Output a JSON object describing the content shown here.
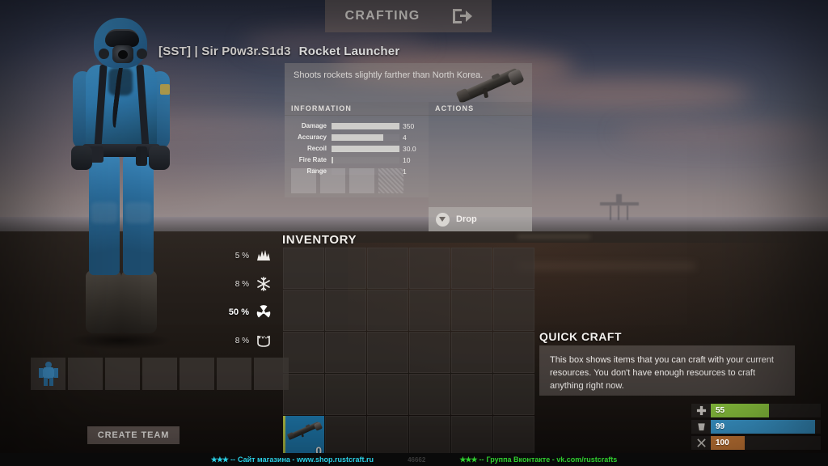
{
  "header": {
    "crafting_tab_label": "CRAFTING",
    "exit_icon": "exit-door-arrow-icon"
  },
  "item": {
    "owner_tag": "[SST] | Sir P0w3r.S1d3",
    "name": "Rocket Launcher",
    "description": "Shoots rockets slightly farther than North Korea.",
    "icon": "rocket-launcher-icon",
    "information_header": "INFORMATION",
    "actions_header": "ACTIONS",
    "stats": [
      {
        "label": "Damage",
        "value": "350",
        "fill_pct": 100
      },
      {
        "label": "Accuracy",
        "value": "4",
        "fill_pct": 76
      },
      {
        "label": "Recoil",
        "value": "30.0",
        "fill_pct": 100
      },
      {
        "label": "Fire Rate",
        "value": "10",
        "fill_pct": 2
      },
      {
        "label": "Range",
        "value": "1",
        "fill_pct": 0
      }
    ],
    "actions": {
      "drop_label": "Drop",
      "drop_icon": "chevron-down-circle-icon"
    }
  },
  "protection": [
    {
      "value": "5 %",
      "icon": "explosion-icon",
      "highlight": false
    },
    {
      "value": "8 %",
      "icon": "snowflake-icon",
      "highlight": false
    },
    {
      "value": "50 %",
      "icon": "radiation-icon",
      "highlight": true
    },
    {
      "value": "8 %",
      "icon": "bite-jaws-icon",
      "highlight": false
    }
  ],
  "inventory": {
    "title": "INVENTORY",
    "columns": 6,
    "rows": 5,
    "items": [
      {
        "slot": 24,
        "name": "Rocket Launcher",
        "icon": "rocket-launcher-icon",
        "count": "0",
        "condition_pct": 100
      }
    ]
  },
  "armor": {
    "slot_count": 7,
    "items": [
      {
        "slot": 0,
        "name": "Hazmat Suit",
        "icon": "hazmat-suit-icon"
      }
    ]
  },
  "create_team": {
    "label": "CREATE TEAM"
  },
  "quick_craft": {
    "title": "QUICK CRAFT",
    "body": "This box shows items that you can craft with your current resources. You don't have enough resources to craft anything right now."
  },
  "vitals": [
    {
      "name": "health",
      "icon": "cross-icon",
      "value": "55",
      "fill_pct": 55,
      "color": "#8cc63f"
    },
    {
      "name": "thirst",
      "icon": "droplet-icon",
      "value": "99",
      "fill_pct": 99,
      "color": "#3d9fd6"
    },
    {
      "name": "hunger",
      "icon": "bone-icon",
      "value": "100",
      "fill_pct": 32,
      "color": "#d4803a"
    }
  ],
  "banner": {
    "left_stars": "★★★",
    "left_dashes": "--",
    "left_text": "Сайт магазина - www.shop.rustcraft.ru",
    "left_color": "#2ad2e8",
    "mid_text": "46662",
    "right_stars": "★★★",
    "right_dashes": "--",
    "right_text": "Группа Вконтакте - vk.com/rustcrafts",
    "right_color": "#2fd02f"
  }
}
